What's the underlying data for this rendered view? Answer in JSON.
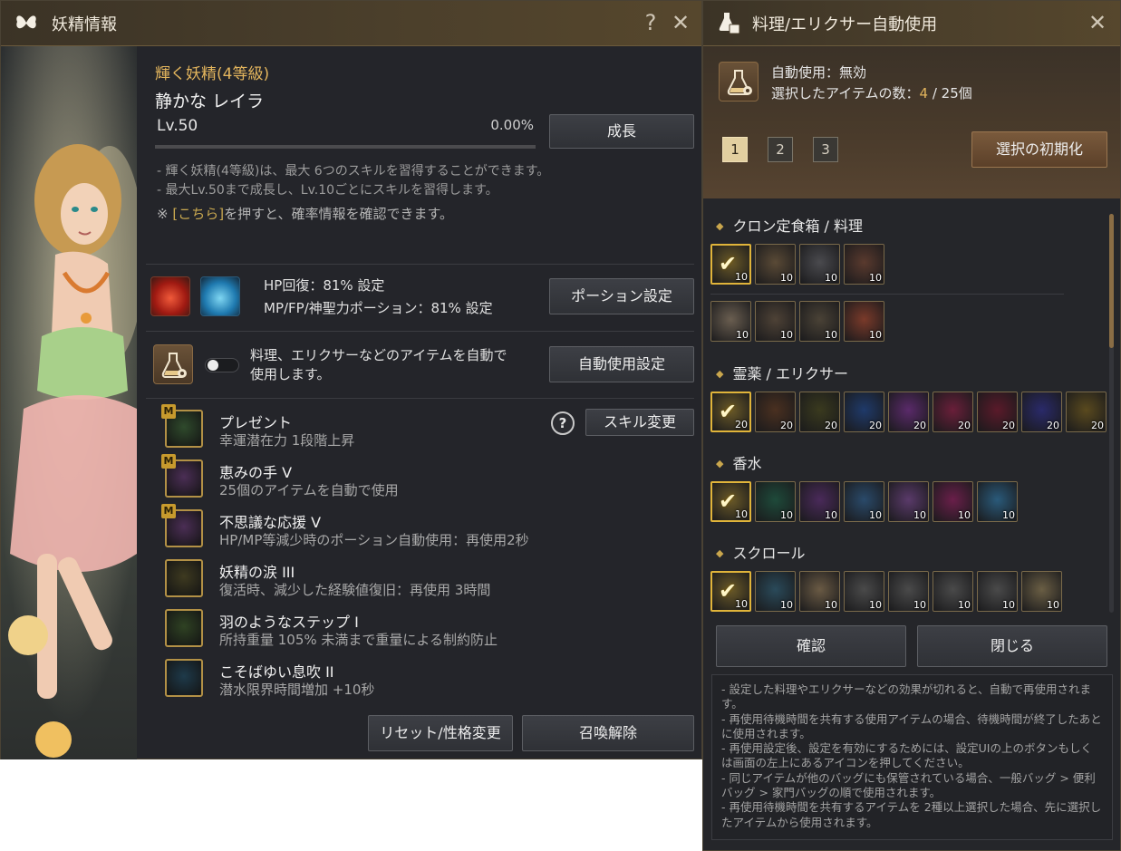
{
  "fairy_window": {
    "title": "妖精情報",
    "help_icon": "?",
    "close_icon": "✕",
    "grade": "輝く妖精(4等級)",
    "name": "静かな レイラ",
    "level": "Lv.50",
    "exp_percent_text": "0.00%",
    "exp_fraction": 0.0,
    "grow_button": "成長",
    "descriptions": [
      "- 輝く妖精(4等級)は、最大 6つのスキルを習得することができます。",
      "- 最大Lv.50まで成長し、Lv.10ごとにスキルを習得します。"
    ],
    "prob_note_prefix": "※ ",
    "prob_note_link": "[こちら]",
    "prob_note_suffix": "を押すと、確率情報を確認できます。",
    "hp_setting": "HP回復：81% 設定",
    "mp_setting": "MP/FP/神聖力ポーション：81% 設定",
    "potion_button": "ポーション設定",
    "auto_use_text_1": "料理、エリクサーなどのアイテムを自動で",
    "auto_use_text_2": "使用します。",
    "auto_use_button": "自動使用設定",
    "auto_toggle_on": false,
    "skill_change_button": "スキル変更",
    "skill_help": "?",
    "skills": [
      {
        "badge": "M",
        "name": "プレゼント",
        "desc": "幸運潜在力 1段階上昇",
        "icon": "clover-icon",
        "color": "#2f4a2c"
      },
      {
        "badge": "M",
        "name": "恵みの手 V",
        "desc": "25個のアイテムを自動で使用",
        "icon": "fairy-hand-icon",
        "color": "#4b2e55"
      },
      {
        "badge": "M",
        "name": "不思議な応援 V",
        "desc": "HP/MP等減少時のポーション自動使用：再使用2秒",
        "icon": "potion-plus-icon",
        "color": "#4b2e55"
      },
      {
        "badge": "",
        "name": "妖精の涙 III",
        "desc": "復活時、減少した経験値復旧：再使用 3時間",
        "icon": "winged-vial-icon",
        "color": "#3e3a20"
      },
      {
        "badge": "",
        "name": "羽のようなステップ I",
        "desc": "所持重量 105% 未満まで重量による制約防止",
        "icon": "weight-arrow-icon",
        "color": "#2f4223"
      },
      {
        "badge": "",
        "name": "こそばゆい息吹 II",
        "desc": "潜水限界時間増加 +10秒",
        "icon": "bubble-timer-icon",
        "color": "#1e3a4a"
      }
    ],
    "reset_button": "リセット/性格変更",
    "dismiss_button": "召喚解除"
  },
  "auto_window": {
    "title": "料理/エリクサー自動使用",
    "close_icon": "✕",
    "status": "自動使用：無効",
    "selected_label": "選択したアイテムの数：",
    "selected_count": "4",
    "selected_total": " / 25個",
    "pages": [
      "1",
      "2",
      "3"
    ],
    "active_page": "1",
    "reset_button": "選択の初期化",
    "categories": [
      {
        "title": "クロン定食箱 / 料理"
      },
      {
        "title": "霊薬 / エリクサー"
      },
      {
        "title": "香水"
      },
      {
        "title": "スクロール"
      }
    ],
    "confirm_button": "確認",
    "close_button": "閉じる",
    "notes": [
      "- 設定した料理やエリクサーなどの効果が切れると、自動で再使用されます。",
      "- 再使用待機時間を共有する使用アイテムの場合、待機時間が終了したあとに使用されます。",
      "- 再使用設定後、設定を有効にするためには、設定UIの上のボタンもしくは画面の左上にあるアイコンを押してください。",
      "- 同じアイテムが他のバッグにも保管されている場合、一般バッグ > 便利バッグ > 家門バッグの順で使用されます。",
      "- 再使用待機時間を共有するアイテムを 2種以上選択した場合、先に選択したアイテムから使用されます。"
    ]
  },
  "items": {
    "food_row1": [
      {
        "qty": "10",
        "selected": true,
        "color": "#6b5a28"
      },
      {
        "qty": "10",
        "selected": false,
        "color": "#5a4a36"
      },
      {
        "qty": "10",
        "selected": false,
        "color": "#4a4a4e"
      },
      {
        "qty": "10",
        "selected": false,
        "color": "#5a3a2e"
      }
    ],
    "food_row2": [
      {
        "qty": "10",
        "selected": false,
        "color": "#6a5e50"
      },
      {
        "qty": "10",
        "selected": false,
        "color": "#4e4236"
      },
      {
        "qty": "10",
        "selected": false,
        "color": "#4a4236"
      },
      {
        "qty": "10",
        "selected": false,
        "color": "#7a3a2a"
      }
    ],
    "elixir": [
      {
        "qty": "20",
        "selected": true,
        "color": "#6b5a28"
      },
      {
        "qty": "20",
        "selected": false,
        "color": "#4a3020"
      },
      {
        "qty": "20",
        "selected": false,
        "color": "#3a3a1e"
      },
      {
        "qty": "20",
        "selected": false,
        "color": "#1f3a6a"
      },
      {
        "qty": "20",
        "selected": false,
        "color": "#5a2a6a"
      },
      {
        "qty": "20",
        "selected": false,
        "color": "#6a1f3a"
      },
      {
        "qty": "20",
        "selected": false,
        "color": "#5a1a2a"
      },
      {
        "qty": "20",
        "selected": false,
        "color": "#2a2a6a"
      },
      {
        "qty": "20",
        "selected": false,
        "color": "#5a4a1e"
      }
    ],
    "perfume": [
      {
        "qty": "10",
        "selected": true,
        "color": "#6b5a28"
      },
      {
        "qty": "10",
        "selected": false,
        "color": "#1e4a3a"
      },
      {
        "qty": "10",
        "selected": false,
        "color": "#4a2a5a"
      },
      {
        "qty": "10",
        "selected": false,
        "color": "#2a4a6a"
      },
      {
        "qty": "10",
        "selected": false,
        "color": "#5a3a6a"
      },
      {
        "qty": "10",
        "selected": false,
        "color": "#6a1f4a"
      },
      {
        "qty": "10",
        "selected": false,
        "color": "#2a5a7a"
      }
    ],
    "scroll": [
      {
        "qty": "10",
        "selected": true,
        "color": "#6b5a28"
      },
      {
        "qty": "10",
        "selected": false,
        "color": "#2a4a5a"
      },
      {
        "qty": "10",
        "selected": false,
        "color": "#6a5a44"
      },
      {
        "qty": "10",
        "selected": false,
        "color": "#4a4a4a"
      },
      {
        "qty": "10",
        "selected": false,
        "color": "#4a4a4a"
      },
      {
        "qty": "10",
        "selected": false,
        "color": "#4a4a4a"
      },
      {
        "qty": "10",
        "selected": false,
        "color": "#4a4a4a"
      },
      {
        "qty": "10",
        "selected": false,
        "color": "#6a5e44"
      }
    ]
  },
  "colors": {
    "accent_gold": "#c9a64d",
    "panel_bg": "#24252a",
    "title_bar": "#4b3f2b"
  }
}
